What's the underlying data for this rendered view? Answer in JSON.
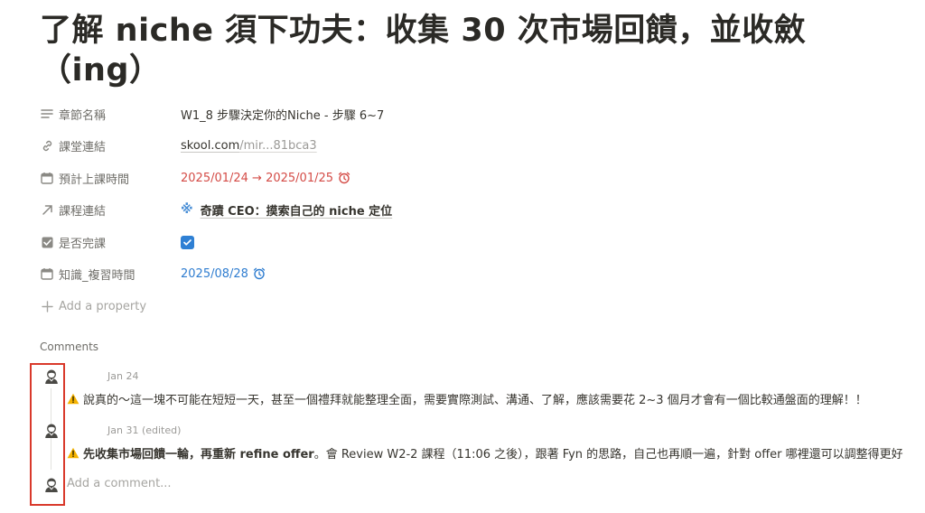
{
  "page": {
    "title": "了解 niche 須下功夫：收集 30 次市場回饋，並收斂（ing）"
  },
  "properties": {
    "chapter_name": {
      "label": "章節名稱",
      "value": "W1_8 步驟決定你的Niche - 步驟 6~7"
    },
    "course_link": {
      "label": "課堂連結",
      "domain": "skool.com",
      "path": "/mir...81bca3"
    },
    "planned_time": {
      "label": "預計上課時間",
      "value": "2025/01/24 → 2025/01/25"
    },
    "course_relation": {
      "label": "課程連結",
      "icon": "※",
      "value": "奇蹟 CEO：摸索自己的 niche 定位"
    },
    "completed": {
      "label": "是否完課",
      "checked": true
    },
    "review_time": {
      "label": "知識_複習時間",
      "value": "2025/08/28"
    },
    "add_property": "Add a property"
  },
  "comments": {
    "heading": "Comments",
    "items": [
      {
        "date": "Jan 24",
        "text": "說真的～這一塊不可能在短短一天，甚至一個禮拜就能整理全面，需要實際測試、溝通、了解，應該需要花 2~3 個月才會有一個比較通盤面的理解！！"
      },
      {
        "date": "Jan 31 (edited)",
        "bold": "先收集市場回饋一輪，再重新 refine offer",
        "text": "。會 Review W2-2 課程（11:06 之後），跟著 Fyn 的思路，自己也再順一遍，針對 offer 哪裡還可以調整得更好"
      }
    ],
    "placeholder": "Add a comment..."
  },
  "colors": {
    "date_red": "#d44c47",
    "date_blue": "#2f7dd0",
    "checkbox": "#2f80d4",
    "highlight": "#d9392b"
  }
}
